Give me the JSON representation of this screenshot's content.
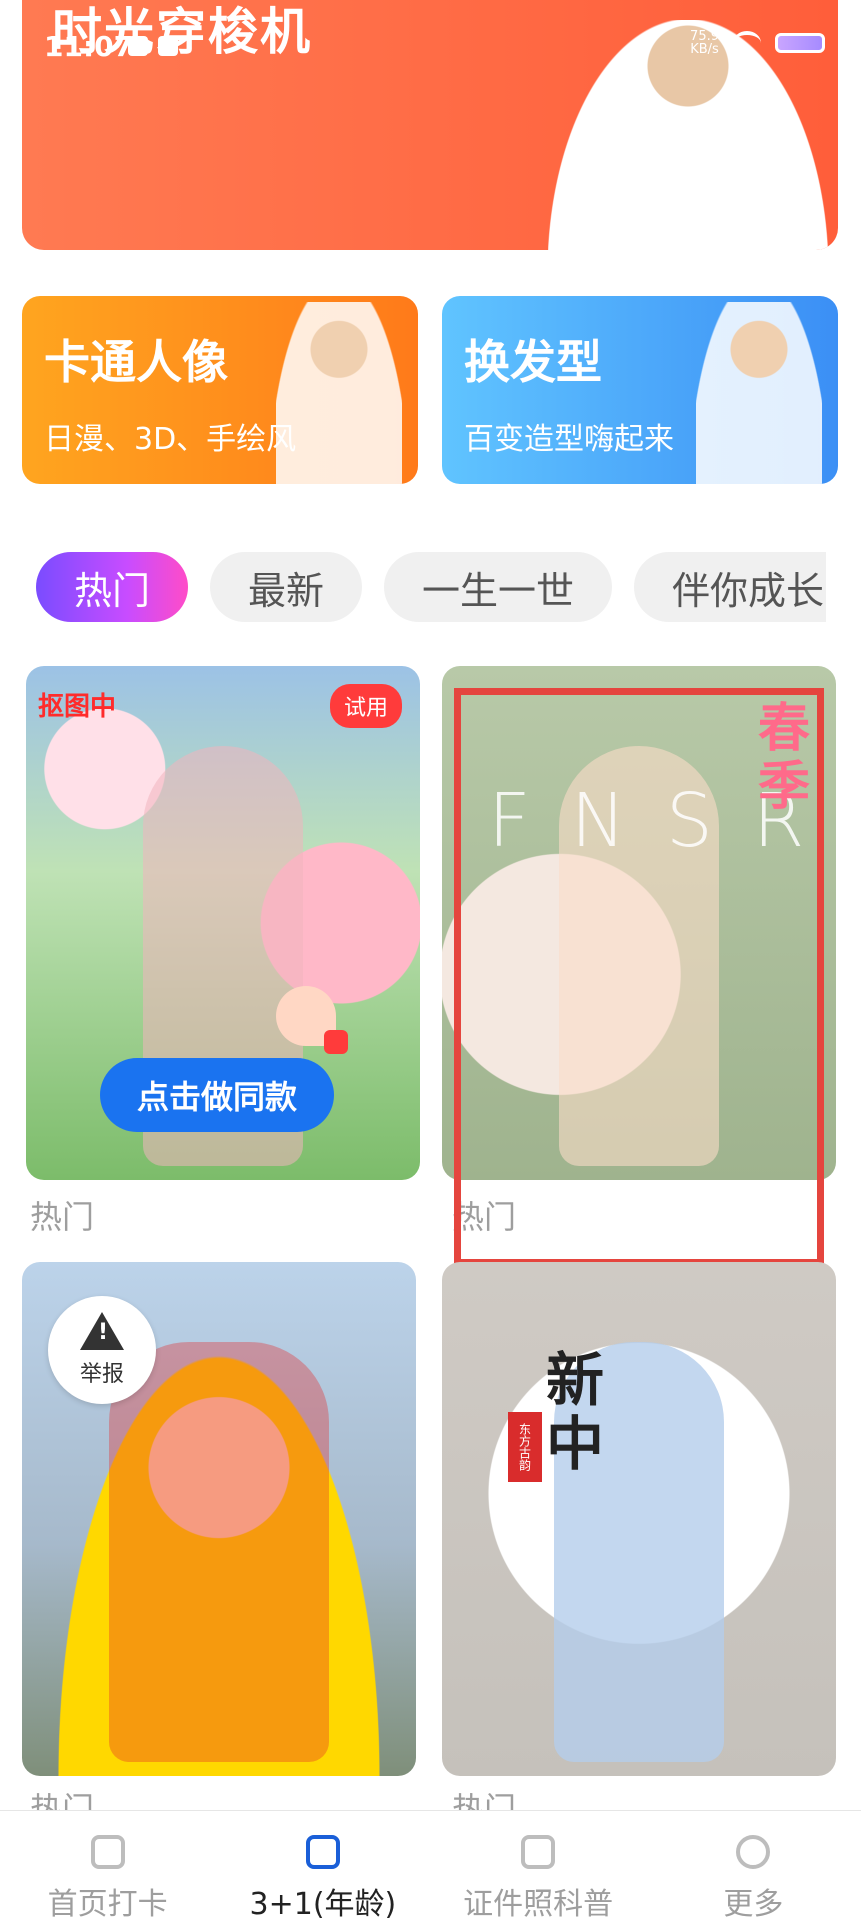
{
  "status_bar": {
    "time": "11:07",
    "net_speed_value": "75.9",
    "net_speed_unit": "KB/s"
  },
  "top_banner": {
    "title": "时光穿梭机"
  },
  "feature_cards": [
    {
      "title": "卡通人像",
      "subtitle": "日漫、3D、手绘风"
    },
    {
      "title": "换发型",
      "subtitle": "百变造型嗨起来"
    }
  ],
  "filter_chips": {
    "items": [
      "热门",
      "最新",
      "一生一世",
      "伴你成长"
    ],
    "active_index": 0
  },
  "grid": {
    "cards": [
      {
        "label": "热门",
        "cutout_tag": "抠图中",
        "trial_badge": "试用",
        "cta": "点击做同款"
      },
      {
        "label": "热门",
        "title_vertical": "春季",
        "letters": "FNSRIG"
      },
      {
        "label": "热门",
        "report_label": "举报"
      },
      {
        "label": "热门",
        "title_vertical": "新中",
        "seal": "东方古韵"
      }
    ]
  },
  "bottom_nav": {
    "items": [
      "首页打卡",
      "3+1(年龄)",
      "证件照科普",
      "更多"
    ],
    "active_index": 1
  },
  "colors": {
    "primary_blue": "#1a73f0",
    "highlight": "#e5453e",
    "accent_orange": "#ff5e3a"
  }
}
